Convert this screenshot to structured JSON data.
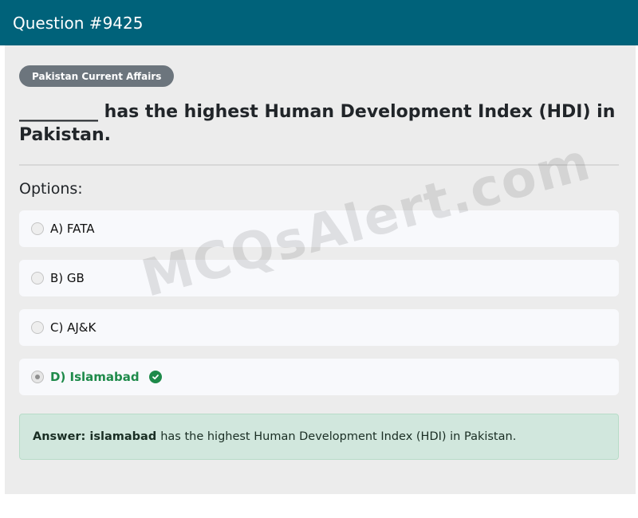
{
  "header": {
    "title": "Question #9425"
  },
  "category_badge": "Pakistan Current Affairs",
  "question": {
    "text": "_________ has the highest Human Development Index (HDI) in Pakistan."
  },
  "options_label": "Options:",
  "options": [
    {
      "label": "A) FATA",
      "selected": false,
      "correct": false
    },
    {
      "label": "B) GB",
      "selected": false,
      "correct": false
    },
    {
      "label": "C) AJ&K",
      "selected": false,
      "correct": false
    },
    {
      "label": "D) Islamabad",
      "selected": true,
      "correct": true
    }
  ],
  "answer": {
    "prefix": "Answer: islamabad",
    "explanation": "has the highest Human Development Index (HDI) in Pakistan."
  },
  "watermark": "MCQsAlert.com",
  "colors": {
    "header_bg": "#00627a",
    "correct_green": "#1e8a4a",
    "answer_bg": "#d1e7dd",
    "badge_bg": "#6c757d"
  },
  "icons": {
    "correct": "check-circle-icon",
    "option": "radio-icon"
  }
}
